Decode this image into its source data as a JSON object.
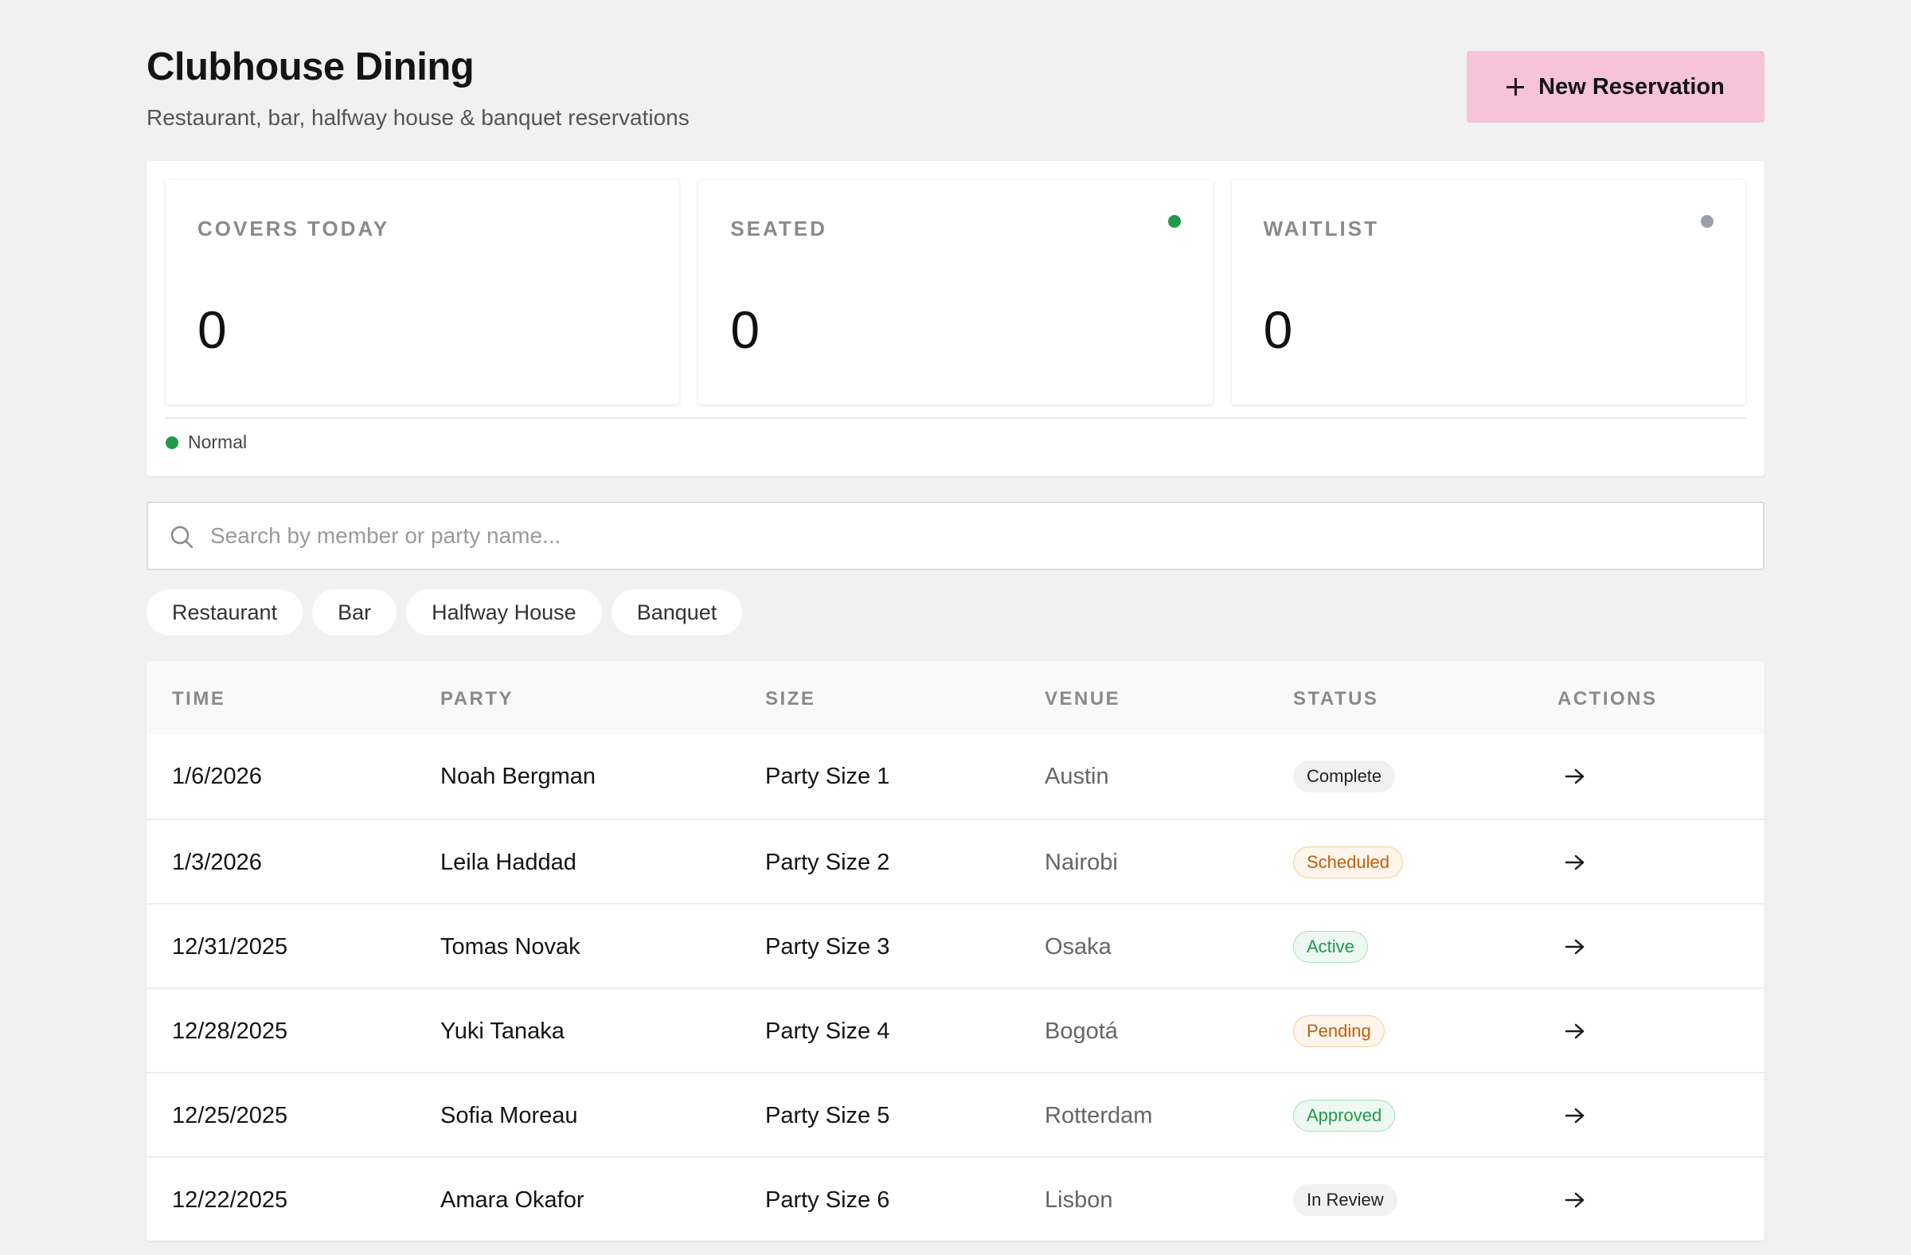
{
  "header": {
    "title": "Clubhouse Dining",
    "subtitle": "Restaurant, bar, halfway house & banquet reservations",
    "new_button_label": "New Reservation"
  },
  "stats": [
    {
      "label": "COVERS TODAY",
      "value": "0",
      "indicator": null
    },
    {
      "label": "SEATED",
      "value": "0",
      "indicator": "#1f9a49"
    },
    {
      "label": "WAITLIST",
      "value": "0",
      "indicator": "#9aa0aa"
    }
  ],
  "status": {
    "label": "Normal",
    "color": "#1f9a49"
  },
  "search": {
    "placeholder": "Search by member or party name..."
  },
  "filters": [
    "Restaurant",
    "Bar",
    "Halfway House",
    "Banquet"
  ],
  "table": {
    "columns": [
      "TIME",
      "PARTY",
      "SIZE",
      "VENUE",
      "STATUS",
      "ACTIONS"
    ],
    "rows": [
      {
        "time": "1/6/2026",
        "party": "Noah Bergman",
        "size": "Party Size 1",
        "venue": "Austin",
        "status": "Complete",
        "status_tone": "neutral"
      },
      {
        "time": "1/3/2026",
        "party": "Leila Haddad",
        "size": "Party Size 2",
        "venue": "Nairobi",
        "status": "Scheduled",
        "status_tone": "warn"
      },
      {
        "time": "12/31/2025",
        "party": "Tomas Novak",
        "size": "Party Size 3",
        "venue": "Osaka",
        "status": "Active",
        "status_tone": "ok"
      },
      {
        "time": "12/28/2025",
        "party": "Yuki Tanaka",
        "size": "Party Size 4",
        "venue": "Bogotá",
        "status": "Pending",
        "status_tone": "warn"
      },
      {
        "time": "12/25/2025",
        "party": "Sofia Moreau",
        "size": "Party Size 5",
        "venue": "Rotterdam",
        "status": "Approved",
        "status_tone": "ok"
      },
      {
        "time": "12/22/2025",
        "party": "Amara Okafor",
        "size": "Party Size 6",
        "venue": "Lisbon",
        "status": "In Review",
        "status_tone": "neutral"
      }
    ]
  },
  "colors": {
    "accent": "#f6c3d9",
    "background": "#f1f1f1"
  }
}
